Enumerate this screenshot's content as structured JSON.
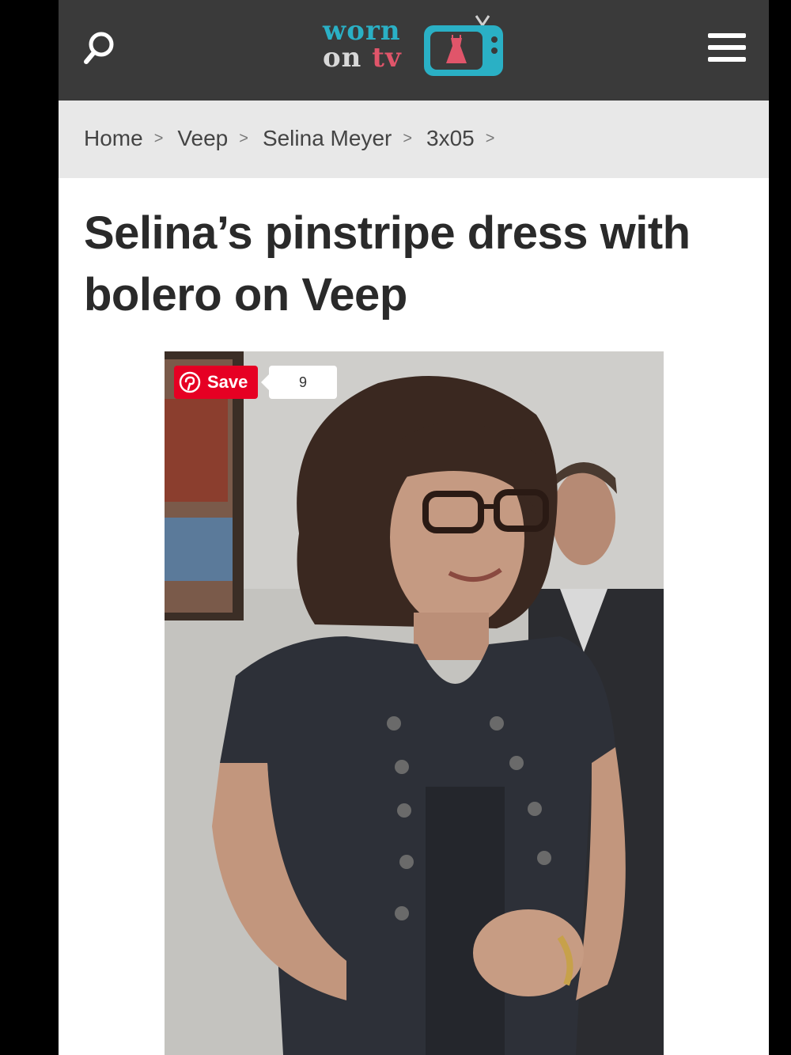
{
  "header": {
    "logo_line1": "worn",
    "logo_line2_a": "on",
    "logo_line2_b": "tv",
    "icons": [
      "search-icon",
      "logo-tv-icon",
      "hamburger-menu-icon"
    ],
    "colors": {
      "bar": "#3a3a3a",
      "logo_teal": "#2ab0c5",
      "logo_pink": "#e0556a"
    }
  },
  "breadcrumb": {
    "items": [
      "Home",
      "Veep",
      "Selina Meyer",
      "3x05"
    ],
    "separator": ">"
  },
  "article": {
    "title": "Selina’s pinstripe dress with bolero on Veep"
  },
  "pinterest": {
    "save_label": "Save",
    "count": "9",
    "color": "#e60023"
  }
}
